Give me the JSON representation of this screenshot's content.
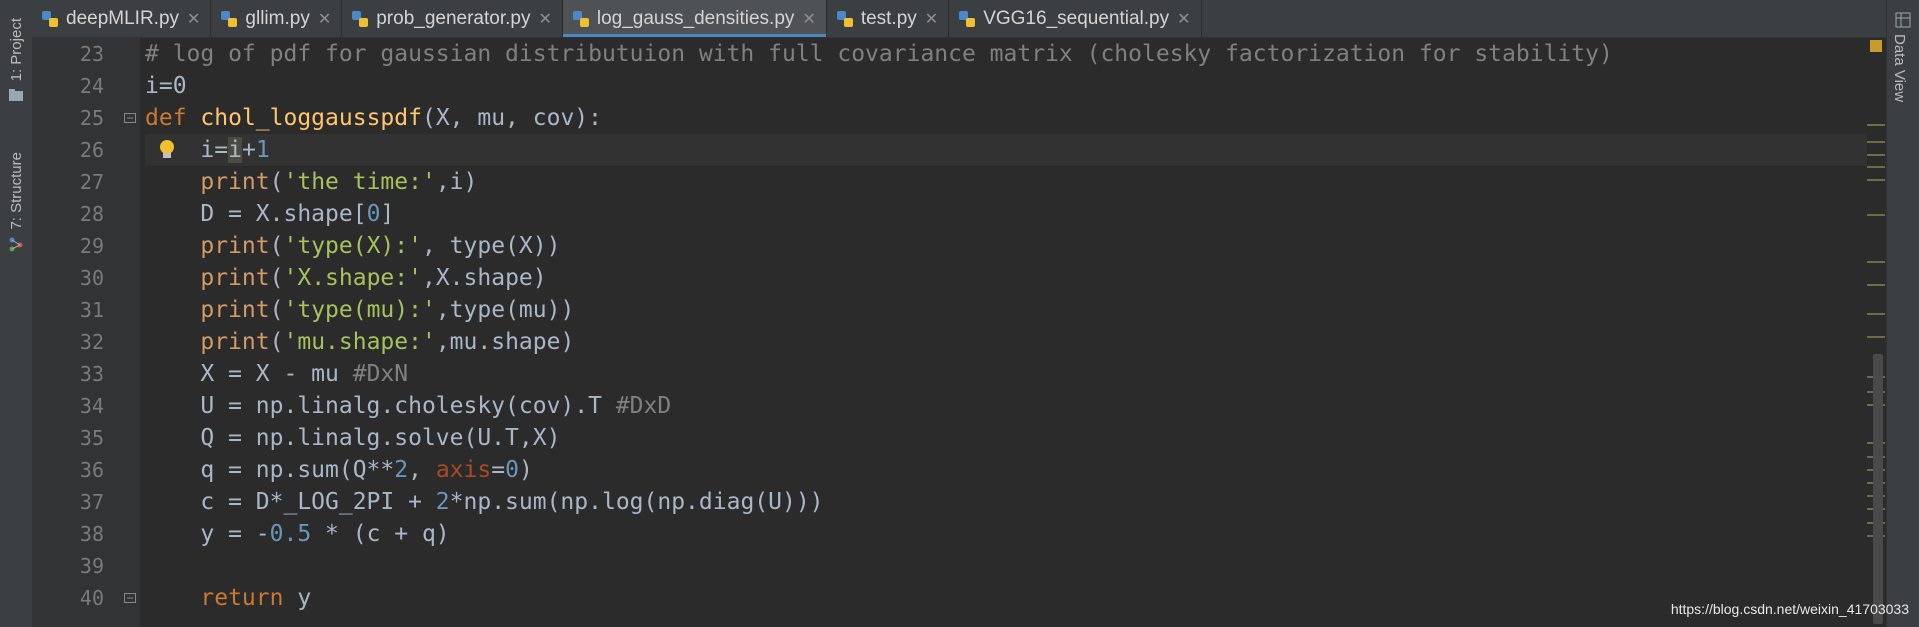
{
  "left_tools": {
    "project": "1: Project",
    "structure": "7: Structure"
  },
  "right_tools": {
    "data_view": "Data View"
  },
  "tabs": [
    {
      "label": "deepMLIR.py"
    },
    {
      "label": "gllim.py"
    },
    {
      "label": "prob_generator.py"
    },
    {
      "label": "log_gauss_densities.py"
    },
    {
      "label": "test.py"
    },
    {
      "label": "VGG16_sequential.py"
    }
  ],
  "line_numbers": [
    "23",
    "24",
    "25",
    "26",
    "27",
    "28",
    "29",
    "30",
    "31",
    "32",
    "33",
    "34",
    "35",
    "36",
    "37",
    "38",
    "39",
    "40"
  ],
  "code": {
    "l23": "# log of pdf for gaussian distributuion with full covariance matrix (cholesky factorization for stability)",
    "l24": "i=0",
    "l25_kw": "def",
    "l25_fn": "chol_loggausspdf",
    "l25_rest": "(X, mu, cov):",
    "l26_a": "i=",
    "l26_b": "i",
    "l26_c": "+",
    "l26_num": "1",
    "l27_fn": "print",
    "l27_str": "'the time:'",
    "l27_rest": ",i)",
    "l28_a": "D = X.shape[",
    "l28_num": "0",
    "l28_b": "]",
    "l29_fn": "print",
    "l29_str": "'type(X):'",
    "l29_rest": ", type(X))",
    "l30_fn": "print",
    "l30_str": "'X.shape:'",
    "l30_rest": ",X.shape)",
    "l31_fn": "print",
    "l31_str": "'type(mu):'",
    "l31_rest": ",type(mu))",
    "l32_fn": "print",
    "l32_str": "'mu.shape:'",
    "l32_rest": ",mu.shape)",
    "l33_a": "X = X - mu ",
    "l33_cmt": "#DxN",
    "l34_a": "U = np.linalg.cholesky(cov).T ",
    "l34_cmt": "#DxD",
    "l35": "Q = np.linalg.solve(U.T,X)",
    "l36_a": "q = np.sum(Q**",
    "l36_num": "2",
    "l36_b": ", ",
    "l36_named": "axis",
    "l36_c": "=",
    "l36_num2": "0",
    "l36_d": ")",
    "l37_a": "c = D*_LOG_2PI + ",
    "l37_num": "2",
    "l37_b": "*np.sum(np.log(np.diag(U)))",
    "l38_a": "y = -",
    "l38_num": "0.5",
    "l38_b": " * (c + q)",
    "l40_kw": "return",
    "l40_rest": " y"
  },
  "watermark": "https://blog.csdn.net/weixin_41703033",
  "colors": {
    "keyword": "#cc7832",
    "function": "#ffc66d",
    "number": "#6897bb",
    "string": "#a5c25c",
    "comment": "#808080"
  }
}
